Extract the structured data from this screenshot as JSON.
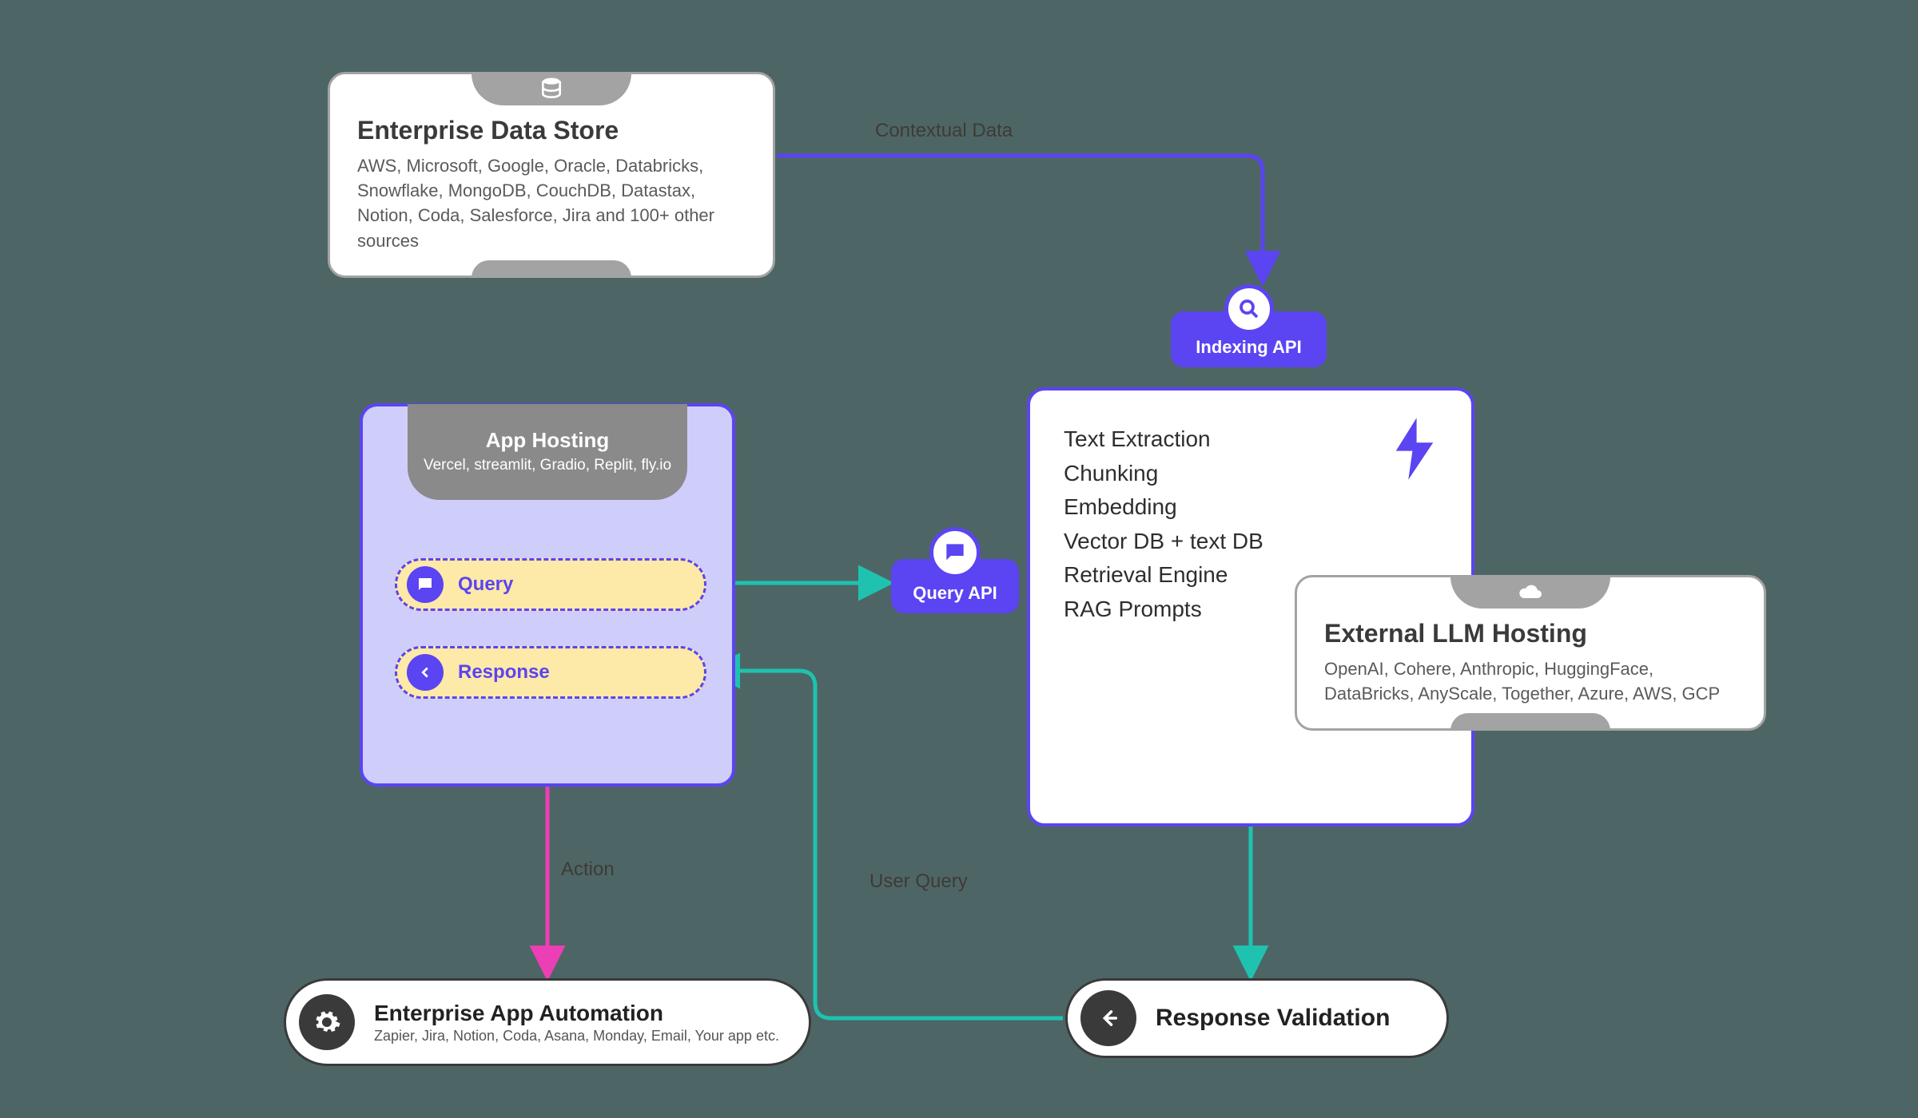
{
  "eds": {
    "title": "Enterprise Data Store",
    "desc": "AWS, Microsoft, Google, Oracle, Databricks, Snowflake, MongoDB, CouchDB, Datastax, Notion, Coda, Salesforce, Jira and 100+ other sources"
  },
  "app_hosting": {
    "title": "App Hosting",
    "subtitle": "Vercel, streamlit, Gradio, Replit, fly.io",
    "query_label": "Query",
    "response_label": "Response"
  },
  "indexing_api": {
    "label": "Indexing API"
  },
  "query_api": {
    "label": "Query API"
  },
  "processing": {
    "line1": "Text Extraction",
    "line2": "Chunking",
    "line3": "Embedding",
    "line4": "Vector DB + text DB",
    "line5": "Retrieval Engine",
    "line6": "RAG Prompts"
  },
  "llm": {
    "title": "External LLM Hosting",
    "desc": "OpenAI, Cohere, Anthropic, HuggingFace, DataBricks, AnyScale, Together, Azure, AWS, GCP"
  },
  "automation": {
    "title": "Enterprise App Automation",
    "desc": "Zapier, Jira, Notion, Coda, Asana, Monday, Email, Your app etc."
  },
  "response_validation": {
    "label": "Response Validation"
  },
  "edges": {
    "contextual_data": "Contextual Data",
    "user_query": "User Query",
    "action": "Action"
  },
  "colors": {
    "purple": "#5b44f2",
    "teal": "#1fc2af",
    "magenta": "#ec3eb5",
    "gray": "#a3a3a3"
  }
}
